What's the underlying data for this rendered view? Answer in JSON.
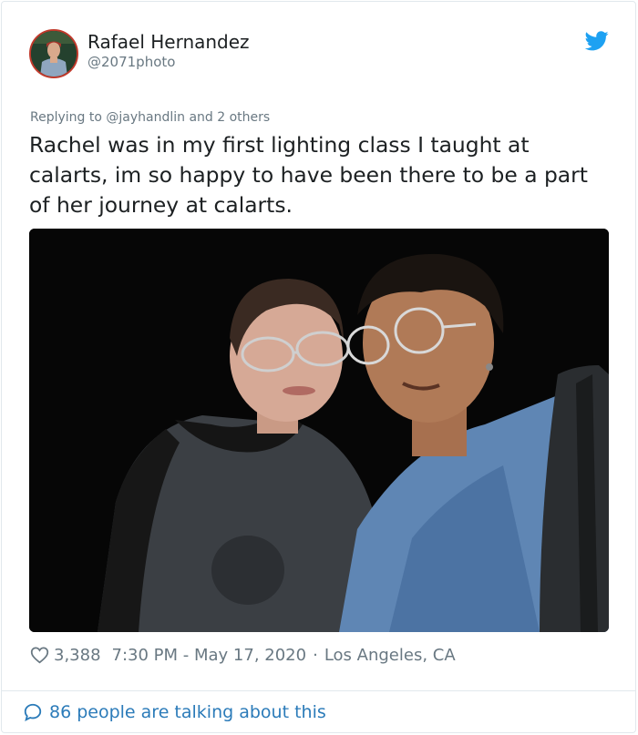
{
  "author": {
    "display_name": "Rafael Hernandez",
    "handle": "@2071photo",
    "avatar_icon": "user-avatar"
  },
  "reply_context": "Replying to @jayhandlin and 2 others",
  "tweet": {
    "text": "Rachel was in my first lighting class I taught at calarts, im so happy to have been there to be a part of her journey at calarts."
  },
  "photo": {
    "icon": "photo"
  },
  "meta": {
    "likes": "3,388",
    "timestamp": "7:30 PM - May 17, 2020",
    "separator": "·",
    "location": "Los Angeles, CA"
  },
  "footer": {
    "talking": "86 people are talking about this"
  },
  "colors": {
    "twitter_blue": "#1da1f2",
    "link_blue": "#2b7bb9",
    "muted": "#697882",
    "text": "#1c2022"
  }
}
